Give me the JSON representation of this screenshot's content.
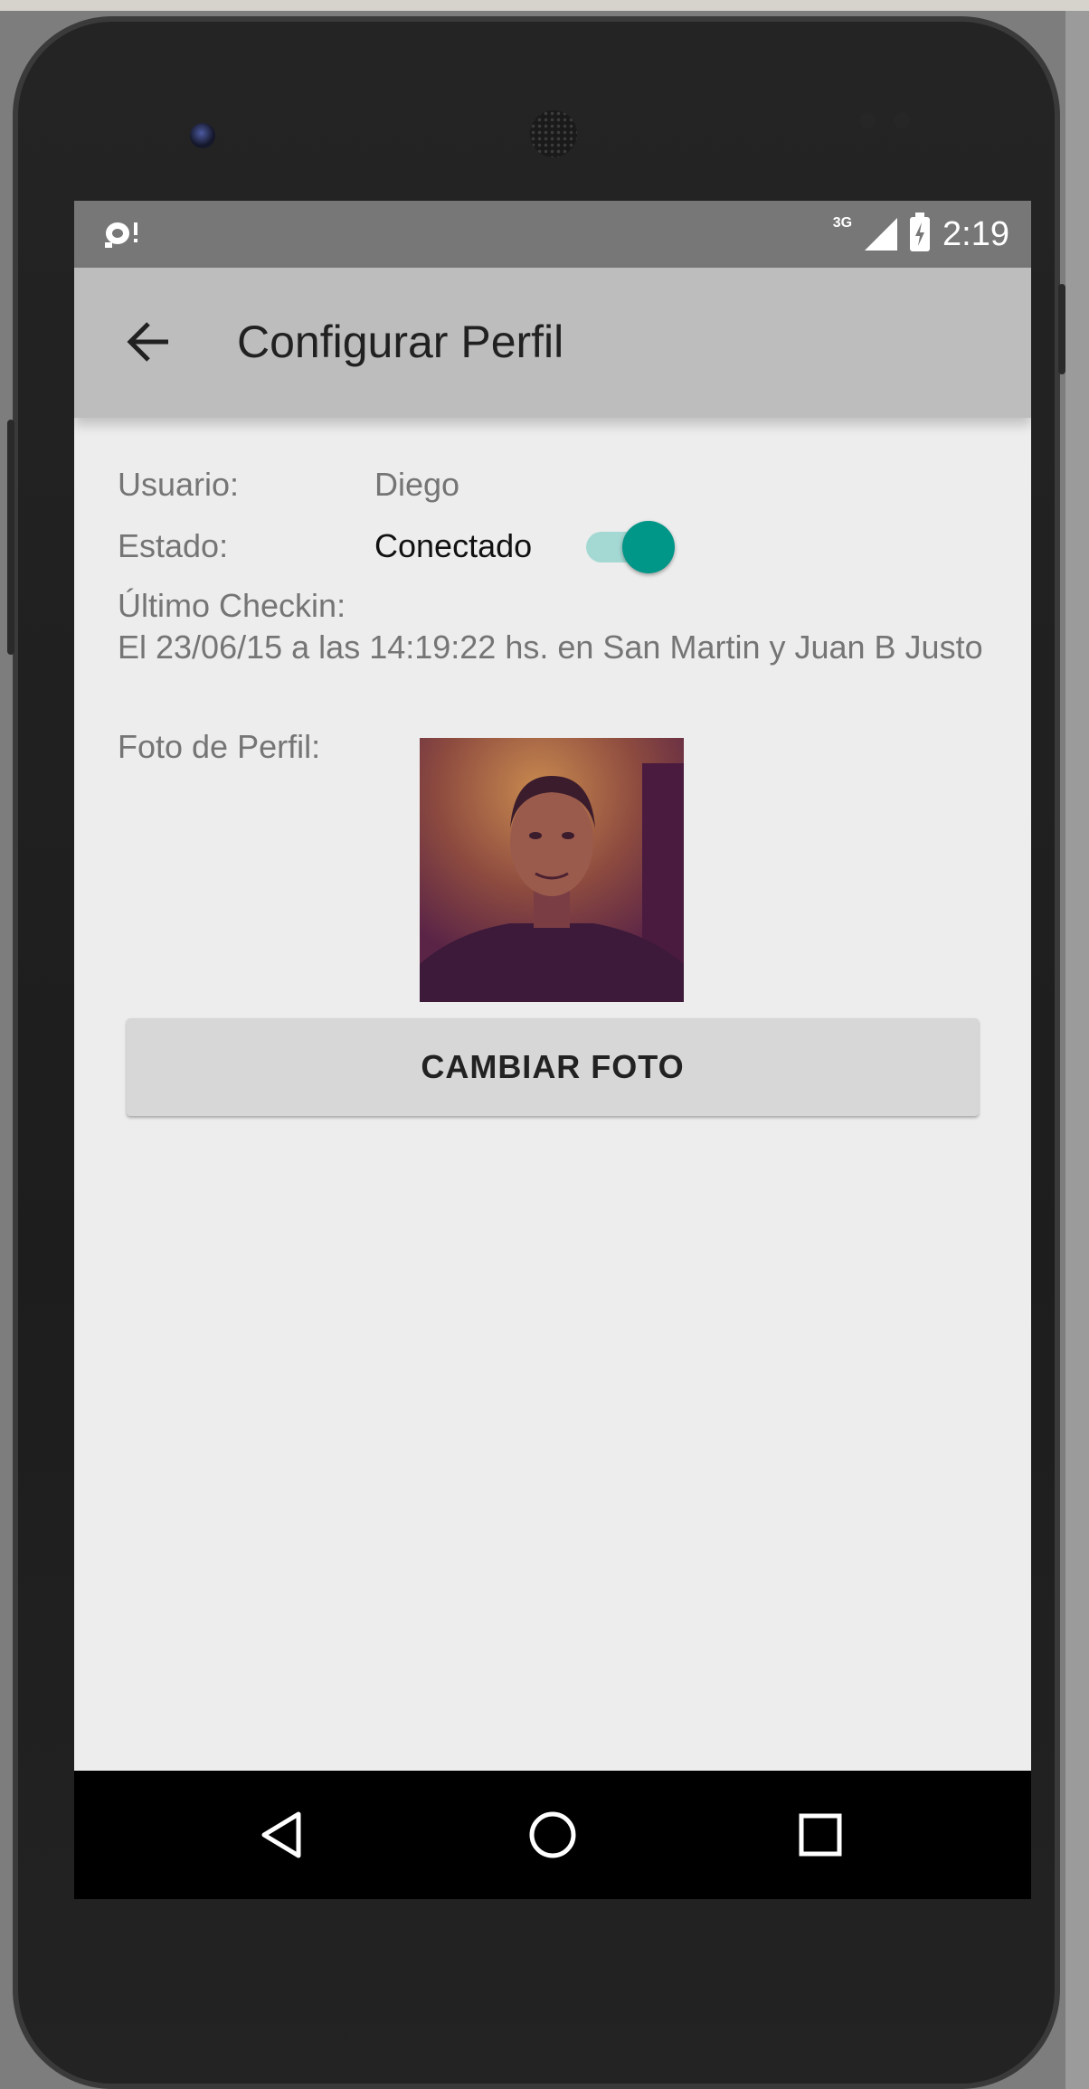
{
  "status_bar": {
    "network": "3G",
    "time": "2:19"
  },
  "toolbar": {
    "title": "Configurar Perfil"
  },
  "profile": {
    "user_label": "Usuario:",
    "user_value": "Diego",
    "state_label": "Estado:",
    "state_value": "Conectado",
    "state_switch_on": true,
    "checkin_label": "Último Checkin:",
    "checkin_value": "El 23/06/15 a las 14:19:22 hs. en  San Martin y Juan B Justo",
    "photo_label": "Foto de Perfil:",
    "change_photo_button": "CAMBIAR FOTO"
  },
  "colors": {
    "accent": "#009688",
    "toolbar": "#bdbdbd",
    "status_bar": "#777777",
    "background": "#ededed"
  },
  "icons": {
    "status_left": "debug-notification-icon",
    "signal": "cell-signal-icon",
    "battery": "battery-charging-icon",
    "back": "arrow-back-icon",
    "nav_back": "triangle-back-icon",
    "nav_home": "circle-home-icon",
    "nav_recents": "square-recents-icon"
  }
}
